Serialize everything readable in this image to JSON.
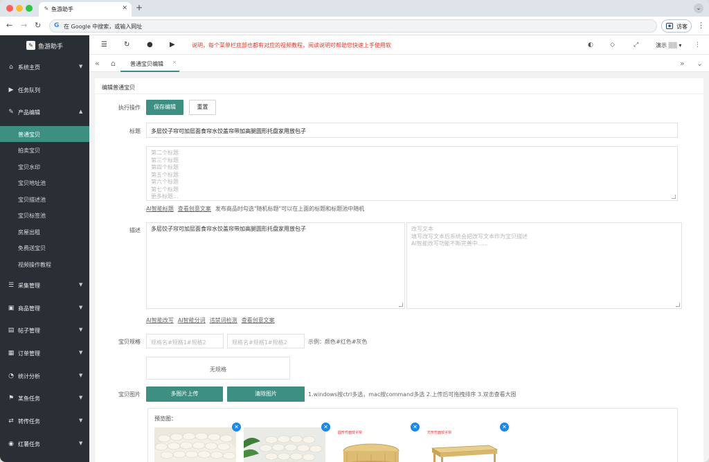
{
  "browser": {
    "tab_title": "鱼游助手",
    "new_tab": "+",
    "omnibox_placeholder": "在 Google 中搜索，或输入网址",
    "guest_label": "访客"
  },
  "sidebar": {
    "brand": "鱼游助手",
    "items": [
      {
        "label": "系统主页",
        "icon": "home-icon"
      },
      {
        "label": "任务队列",
        "icon": "play-icon"
      },
      {
        "label": "产品编辑",
        "icon": "edit-icon"
      }
    ],
    "sub_items": [
      "普通宝贝",
      "拍卖宝贝",
      "宝贝水印",
      "宝贝地址池",
      "宝贝描述池",
      "宝贝标签池",
      "房屋出租",
      "免费送宝贝",
      "视频操作教程"
    ],
    "active_sub": "普通宝贝",
    "more_items": [
      {
        "label": "采集管理",
        "icon": "collect-icon"
      },
      {
        "label": "商品管理",
        "icon": "goods-icon"
      },
      {
        "label": "帖子管理",
        "icon": "post-icon"
      },
      {
        "label": "订单管理",
        "icon": "order-icon"
      },
      {
        "label": "统计分析",
        "icon": "stats-icon"
      },
      {
        "label": "某鱼任务",
        "icon": "fish-icon"
      },
      {
        "label": "转传任务",
        "icon": "transfer-icon"
      },
      {
        "label": "红薯任务",
        "icon": "task-icon"
      }
    ]
  },
  "toolbar": {
    "notice": "说明，每个菜单栏底部也都有对应的视频教程，阅读说明可帮助您快速上手使用软",
    "user_name": "演示"
  },
  "page_tabs": {
    "active_tab": "普通宝贝编辑",
    "close": "×"
  },
  "form": {
    "card_title": "编辑普通宝贝",
    "action_label": "执行操作",
    "save_button": "保存编辑",
    "reset_button": "重置",
    "title_label": "标题",
    "title_value": "多层饺子帘可加层面食帘水饺盖帘带加高腿圆形托盘家用放包子",
    "extra_titles_placeholder": "第二个标题\n第三个标题\n第四个标题\n第五个标题\n第六个标题\n第七个标题\n更多标题...",
    "title_links": [
      "AI智能标题",
      "查看创意文案"
    ],
    "title_hint": "发布商品时勾选\"随机标题\"可以在上面的标题和标题池中随机",
    "desc_label": "描述",
    "desc_value": "多层饺子帘可加层面食帘水饺盖帘带加高腿圆形托盘家用放包子",
    "rewrite_placeholder": "改写文本\n填写改写文本后系统会把改写文本作为宝贝描述\nAI智能改写功能不断完善中......",
    "desc_links": [
      "AI智能改写",
      "AI智能分词",
      "违禁词检测",
      "查看创意文案"
    ],
    "spec_label": "宝贝规格",
    "spec_placeholder_1": "规格名#规格1#规格2",
    "spec_placeholder_2": "规格名#规格1#规格2",
    "spec_example": "示例：颜色#红色#灰色",
    "no_spec": "无规格",
    "image_label": "宝贝图片",
    "upload_button": "多图片上传",
    "clear_button": "清除图片",
    "image_hint": "1.windows按ctrl多选，mac按command多选  2.上传后可拖拽排序  3.双击查看大图",
    "preview_title": "预览图：",
    "thumb_captions": [
      "",
      "",
      "圆形竹面饺子帘",
      "方形竹面饺子帘"
    ]
  },
  "colors": {
    "accent": "#3d8f82",
    "sidebar_bg": "#2a2e35",
    "notice_red": "#e03a28",
    "delete_blue": "#1e88e5"
  }
}
